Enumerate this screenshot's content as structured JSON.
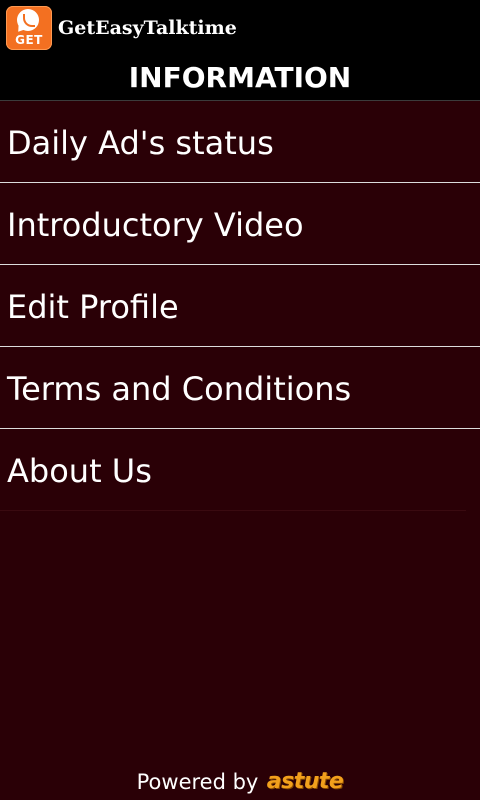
{
  "app": {
    "logo_text": "GET",
    "name": "GetEasyTalktime",
    "accent_color": "#f37021"
  },
  "header": {
    "title": "INFORMATION"
  },
  "menu": {
    "items": [
      {
        "label": "Daily Ad's status"
      },
      {
        "label": "Introductory Video"
      },
      {
        "label": "Edit Profile"
      },
      {
        "label": "Terms and Conditions"
      },
      {
        "label": "About Us"
      }
    ]
  },
  "footer": {
    "powered_by": "Powered by",
    "brand": "astute",
    "brand_color": "#f2a01c"
  },
  "theme": {
    "background": "#2a0006",
    "bar_color": "#000000",
    "divider_color": "#dcdcdc"
  }
}
